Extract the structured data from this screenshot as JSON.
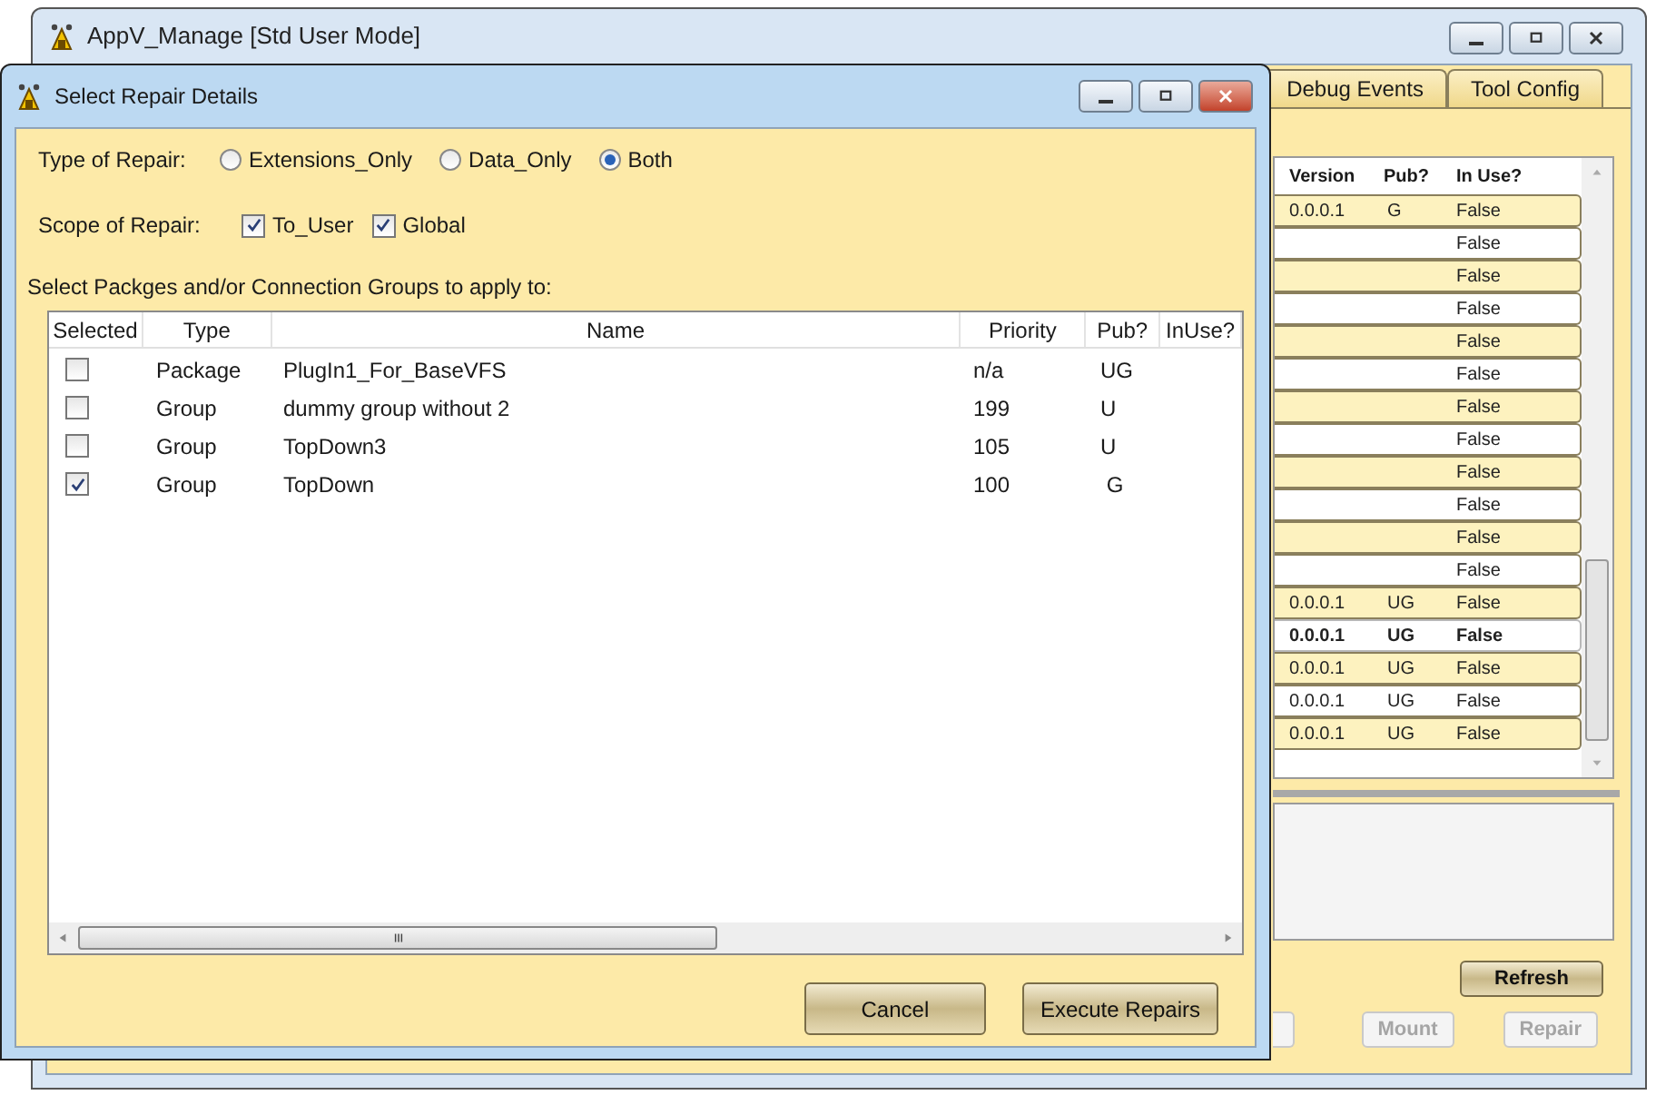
{
  "main_window": {
    "title": "AppV_Manage [Std User Mode]",
    "tabs": [
      {
        "label": "Debug Events",
        "selected": false
      },
      {
        "label": "Tool Config",
        "selected": false
      }
    ],
    "packages_list": {
      "columns": [
        "Version",
        "Pub?",
        "In Use?"
      ],
      "rows": [
        {
          "version": "0.0.0.1",
          "pub": "G",
          "in_use": "False",
          "selected": false
        },
        {
          "version": "",
          "pub": "",
          "in_use": "False",
          "selected": false
        },
        {
          "version": "",
          "pub": "",
          "in_use": "False",
          "selected": false
        },
        {
          "version": "",
          "pub": "",
          "in_use": "False",
          "selected": false
        },
        {
          "version": "",
          "pub": "",
          "in_use": "False",
          "selected": false
        },
        {
          "version": "",
          "pub": "",
          "in_use": "False",
          "selected": false
        },
        {
          "version": "",
          "pub": "",
          "in_use": "False",
          "selected": false
        },
        {
          "version": "",
          "pub": "",
          "in_use": "False",
          "selected": false
        },
        {
          "version": "",
          "pub": "",
          "in_use": "False",
          "selected": false
        },
        {
          "version": "",
          "pub": "",
          "in_use": "False",
          "selected": false
        },
        {
          "version": "",
          "pub": "",
          "in_use": "False",
          "selected": false
        },
        {
          "version": "",
          "pub": "",
          "in_use": "False",
          "selected": false
        },
        {
          "version": "0.0.0.1",
          "pub": "UG",
          "in_use": "False",
          "selected": false
        },
        {
          "version": "0.0.0.1",
          "pub": "UG",
          "in_use": "False",
          "selected": true
        },
        {
          "version": "0.0.0.1",
          "pub": "UG",
          "in_use": "False",
          "selected": false
        },
        {
          "version": "0.0.0.1",
          "pub": "UG",
          "in_use": "False",
          "selected": false
        },
        {
          "version": "0.0.0.1",
          "pub": "UG",
          "in_use": "False",
          "selected": false
        }
      ]
    },
    "buttons": [
      {
        "label": "Refresh",
        "disabled": false
      },
      {
        "label": "Mount",
        "disabled": true
      },
      {
        "label": "Repair",
        "disabled": true
      }
    ]
  },
  "dialog": {
    "title": "Select Repair Details",
    "type_of_repair": {
      "label": "Type of Repair:",
      "options": [
        {
          "label": "Extensions_Only",
          "selected": false
        },
        {
          "label": "Data_Only",
          "selected": false
        },
        {
          "label": "Both",
          "selected": true
        }
      ]
    },
    "scope_of_repair": {
      "label": "Scope of Repair:",
      "options": [
        {
          "label": "To_User",
          "checked": true
        },
        {
          "label": "Global",
          "checked": true
        }
      ]
    },
    "list_label": "Select Packges and/or Connection Groups to apply to:",
    "grid": {
      "columns": [
        "Selected",
        "Type",
        "Name",
        "Priority",
        "Pub?",
        "InUse?"
      ],
      "rows": [
        {
          "checked": false,
          "type": "Package",
          "name": "PlugIn1_For_BaseVFS",
          "priority": "n/a",
          "pub": "UG"
        },
        {
          "checked": false,
          "type": "Group",
          "name": "dummy group without 2",
          "priority": "199",
          "pub": "U"
        },
        {
          "checked": false,
          "type": "Group",
          "name": "TopDown3",
          "priority": "105",
          "pub": "U"
        },
        {
          "checked": true,
          "type": "Group",
          "name": "TopDown",
          "priority": "100",
          "pub": " G"
        }
      ]
    },
    "buttons": [
      "Cancel",
      "Execute Repairs"
    ]
  }
}
